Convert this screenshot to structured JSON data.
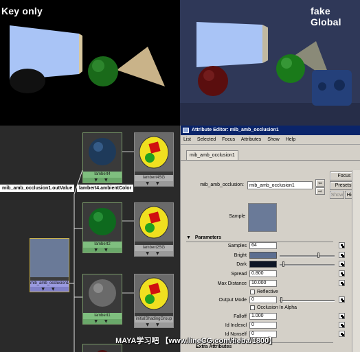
{
  "renders": {
    "left_label": "Key only",
    "right_label": "fake Global"
  },
  "hypergraph": {
    "nodes": [
      {
        "label": "lambert4",
        "arrows": "▼ ▼"
      },
      {
        "label": "lambert4SG",
        "arrows": "▼ ▼"
      },
      {
        "label": "lambert2",
        "arrows": "▼ ▼"
      },
      {
        "label": "lambert2SG",
        "arrows": "▼ ▼"
      },
      {
        "label": "lambert1",
        "arrows": "▼ ▼"
      },
      {
        "label": "initialShadingGroup",
        "arrows": "▼ ▼"
      },
      {
        "label": "mib_amb_occlusion1",
        "arrows": "▼ ▼"
      }
    ],
    "connection_src": "mib_amb_occlusion1.outValue",
    "connection_dst": "lambert4.ambientColor"
  },
  "attr_editor": {
    "title": "Attribute Editor: mib_amb_occlusion1",
    "menu": [
      "List",
      "Selected",
      "Focus",
      "Attributes",
      "Show",
      "Help"
    ],
    "tab": "mib_amb_occlusion1",
    "node_label": "mib_amb_occlusion:",
    "node_value": "mib_amb_occlusion1",
    "buttons": {
      "focus": "Focus",
      "presets": "Presets*",
      "show": "Show",
      "hide": "Hide"
    },
    "sample_label": "Sample",
    "section": "Parameters",
    "section_collapse": "▼",
    "params": {
      "samples_label": "Samples",
      "samples_value": "64",
      "bright_label": "Bright",
      "bright_level": 0.72,
      "dark_label": "Dark",
      "dark_level": 0.05,
      "spread_label": "Spread",
      "spread_value": "0.800",
      "reflective_label": "Reflective",
      "maxdist_label": "Max Distance",
      "maxdist_value": "10.000",
      "outmode_label": "Output Mode",
      "outmode_value": "0",
      "occ_alpha_label": "Occlusion In Alpha",
      "falloff_label": "Falloff",
      "falloff_value": "1.000",
      "inclexcl_label": "Id Inclexcl",
      "inclexcl_value": "0",
      "nonself_label": "Id Nonself",
      "nonself_value": "0"
    },
    "next_section": "Extra Attributes",
    "colors": {
      "bright": "#5c6e90",
      "dark": "#0e1626"
    }
  },
  "watermark": "MAYA学习吧 【www.lineCG.com/tieba/1800】"
}
